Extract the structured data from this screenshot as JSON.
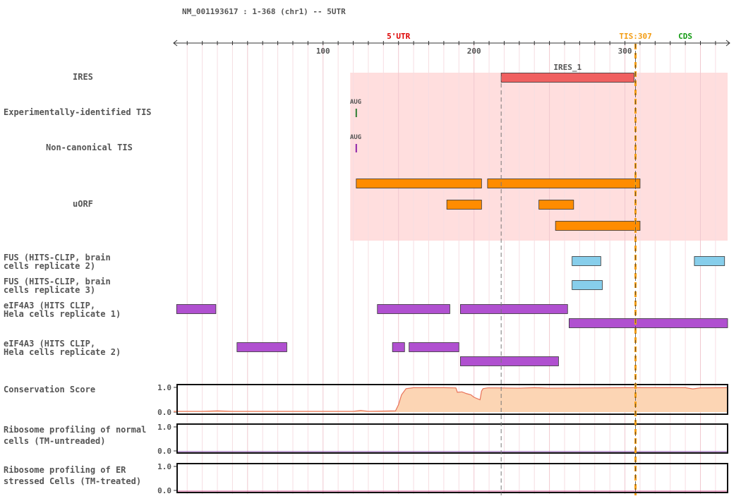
{
  "header": {
    "title": "NM_001193617 : 1-368 (chr1) -- 5UTR"
  },
  "chart_data": {
    "type": "genome-track",
    "x_range": [
      1,
      368
    ],
    "ticks": [
      100,
      200,
      300
    ],
    "regions": [
      {
        "label": "5'UTR",
        "color": "#dd0000",
        "pos": 150
      },
      {
        "label": "TIS:307",
        "color": "#f39c12",
        "pos": 307
      },
      {
        "label": "CDS",
        "color": "#119911",
        "pos": 340
      }
    ],
    "ires_region": {
      "start": 118,
      "end": 368,
      "color": "#ffdede"
    },
    "tis_line": {
      "pos": 307,
      "color": "#f39c12"
    },
    "ires_marker": 218,
    "tracks": [
      {
        "label": "IRES",
        "features": [
          {
            "start": 218,
            "end": 306,
            "color": "#f06060",
            "name": "IRES_1"
          }
        ]
      },
      {
        "label": "Experimentally-identified TIS",
        "ticks": [
          {
            "pos": 122,
            "color": "#2e7d32",
            "label": "AUG"
          }
        ]
      },
      {
        "label": "Non-canonical TIS",
        "ticks": [
          {
            "pos": 122,
            "color": "#8e24aa",
            "label": "AUG"
          }
        ]
      },
      {
        "label": "uORF",
        "features": [
          {
            "start": 122,
            "end": 205,
            "row": 0,
            "color": "#ff8c00"
          },
          {
            "start": 209,
            "end": 310,
            "row": 0,
            "color": "#ff8c00"
          },
          {
            "start": 182,
            "end": 205,
            "row": 1,
            "color": "#ff8c00"
          },
          {
            "start": 243,
            "end": 266,
            "row": 1,
            "color": "#ff8c00"
          },
          {
            "start": 254,
            "end": 310,
            "row": 2,
            "color": "#ff8c00"
          }
        ]
      },
      {
        "label": "FUS (HITS-CLIP, brain cells replicate 2)",
        "lines": [
          "FUS (HITS-CLIP, brain",
          "cells replicate 2)"
        ],
        "features": [
          {
            "start": 265,
            "end": 284,
            "color": "#87ceeb"
          },
          {
            "start": 346,
            "end": 366,
            "color": "#87ceeb"
          }
        ]
      },
      {
        "label": "FUS (HITS-CLIP, brain cells replicate 3)",
        "lines": [
          "FUS (HITS-CLIP, brain",
          "cells replicate 3)"
        ],
        "features": [
          {
            "start": 265,
            "end": 285,
            "color": "#87ceeb"
          }
        ]
      },
      {
        "label": "eIF4A3 (HITS CLIP, Hela cells replicate 1)",
        "lines": [
          "eIF4A3 (HITS CLIP,",
          "Hela cells replicate 1)"
        ],
        "features": [
          {
            "start": 3,
            "end": 29,
            "row": 0,
            "color": "#b050d0"
          },
          {
            "start": 136,
            "end": 184,
            "row": 0,
            "color": "#b050d0"
          },
          {
            "start": 191,
            "end": 262,
            "row": 0,
            "color": "#b050d0"
          },
          {
            "start": 263,
            "end": 368,
            "row": 1,
            "color": "#b050d0"
          }
        ]
      },
      {
        "label": "eIF4A3 (HITS CLIP, Hela cells replicate 2)",
        "lines": [
          "eIF4A3 (HITS CLIP,",
          "Hela cells replicate 2)"
        ],
        "features": [
          {
            "start": 43,
            "end": 76,
            "row": 0,
            "color": "#b050d0"
          },
          {
            "start": 146,
            "end": 154,
            "row": 0,
            "color": "#b050d0"
          },
          {
            "start": 157,
            "end": 190,
            "row": 0,
            "color": "#b050d0"
          },
          {
            "start": 191,
            "end": 256,
            "row": 1,
            "color": "#b050d0"
          }
        ]
      }
    ],
    "signal_tracks": [
      {
        "label": "Conservation Score",
        "lines": [
          "Conservation Score"
        ],
        "ymin": 0.0,
        "ymax": 1.0,
        "fill": "#fcd5b4",
        "stroke": "#e8735a",
        "x": [
          1,
          20,
          30,
          40,
          120,
          125,
          130,
          148,
          150,
          152,
          155,
          160,
          180,
          188,
          189,
          192,
          195,
          198,
          200,
          204,
          205,
          206,
          209,
          215,
          230,
          240,
          250,
          280,
          300,
          340,
          345,
          350,
          368
        ],
        "y": [
          0.03,
          0.03,
          0.05,
          0.03,
          0.03,
          0.07,
          0.03,
          0.05,
          0.3,
          0.7,
          0.95,
          0.99,
          0.99,
          0.98,
          0.8,
          0.82,
          0.75,
          0.7,
          0.6,
          0.5,
          0.85,
          0.95,
          0.98,
          0.98,
          0.97,
          0.99,
          0.97,
          0.98,
          0.99,
          0.99,
          0.94,
          0.98,
          0.99
        ]
      },
      {
        "label": "Ribosome profiling of normal cells (TM-untreaded)",
        "lines": [
          "Ribosome profiling of normal",
          "cells (TM-untreaded)"
        ],
        "ymin": 0.0,
        "ymax": 1.0,
        "baseline_color": "#7b3fa0"
      },
      {
        "label": "Ribosome profiling of ER stressed Cells (TM-treated)",
        "lines": [
          "Ribosome profiling of ER",
          "stressed Cells (TM-treated)"
        ],
        "ymin": 0.0,
        "ymax": 1.0,
        "baseline_color": "#d05090"
      }
    ]
  }
}
